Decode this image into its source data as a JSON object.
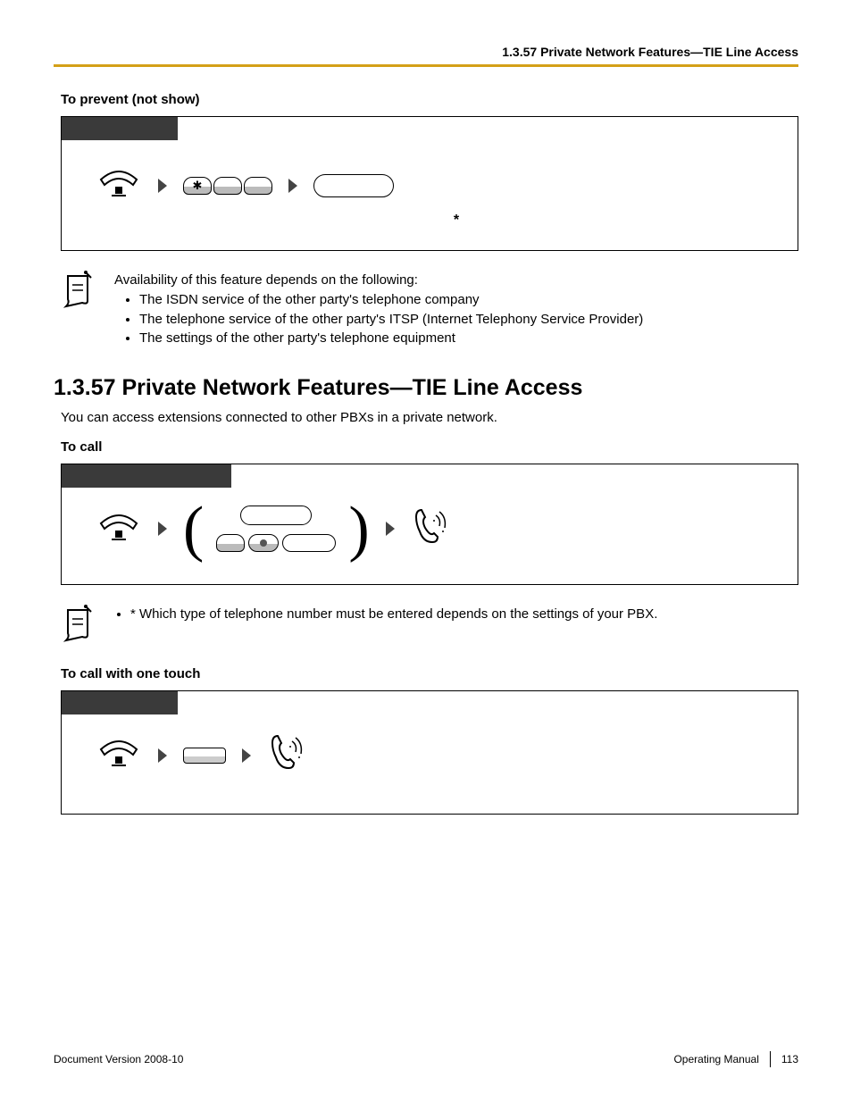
{
  "header": {
    "running_title": "1.3.57 Private Network Features—TIE Line Access"
  },
  "section1": {
    "heading": "To prevent (not show)",
    "asterisk": "*"
  },
  "note1": {
    "intro": "Availability of this feature depends on the following:",
    "items": [
      "The ISDN service of the other party's telephone company",
      "The telephone service of the other party's ITSP (Internet Telephony Service Provider)",
      "The settings of the other party's telephone equipment"
    ]
  },
  "main": {
    "title": "1.3.57  Private Network Features—TIE Line Access",
    "intro": "You can access extensions connected to other PBXs in a private network."
  },
  "section2": {
    "heading": "To call"
  },
  "note2": {
    "text": "* Which type of telephone number must be entered depends on the settings of your PBX."
  },
  "section3": {
    "heading": "To call with one touch"
  },
  "footer": {
    "left": "Document Version  2008-10",
    "right_label": "Operating Manual",
    "page": "113"
  }
}
